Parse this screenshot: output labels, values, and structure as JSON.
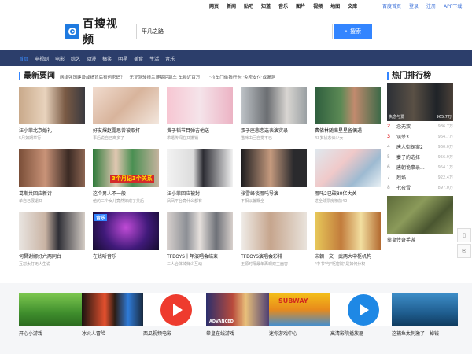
{
  "topbar": {
    "links": [
      "网页",
      "新闻",
      "贴吧",
      "知道",
      "音乐",
      "图片",
      "视频",
      "地图",
      "文库"
    ],
    "right": [
      "百度首页",
      "登录",
      "注册",
      "APP下载"
    ]
  },
  "logo": {
    "name": "百搜视频"
  },
  "search": {
    "value": "平凡之路",
    "button": "搜索"
  },
  "nav": {
    "items": [
      "首页",
      "电视剧",
      "电影",
      "综艺",
      "动漫",
      "搞笑",
      "明星",
      "美食",
      "生活",
      "音乐"
    ],
    "active_index": 0
  },
  "news": {
    "title": "最新要闻",
    "headlines": [
      "网络强国建设成绩背后有何密码？",
      "无证驾驶撞兰博基尼跑车 车损近百万！",
      "\"拉车门偷钱行卡 '免密支付'成漏洞"
    ],
    "items": [
      {
        "caption": "汪小菲北京婚礼",
        "sub": "5月如期举行"
      },
      {
        "caption": "好友爆赵露思曾被取打",
        "sub": "事后说自己离多了"
      },
      {
        "caption": "黄子韬节目弹吉他送",
        "sub": "求婚传闻在又撤销"
      },
      {
        "caption": "双子座悲恋选表演实录",
        "sub": "猫咪由回自觉不已"
      },
      {
        "caption": "费依林随南星星留偶遇",
        "sub": "43岁状态似少女"
      },
      {
        "caption": "葛斯共回应新诗",
        "sub": "单自己展退又"
      },
      {
        "caption": "这个男人不一般！",
        "sub": "他的三个女儿竟然嫁成了美后"
      },
      {
        "caption": "汪小菲回应被封",
        "sub": "凤凤平台竟什么都有"
      },
      {
        "caption": "张雪峰谈哪吒导演",
        "sub": "不相以偏概全"
      },
      {
        "caption": "哪吒2已破80亿大关",
        "sub": "进全球票房榜前40"
      },
      {
        "caption": "何炅谢娜好六两同台",
        "sub": "互怼太打无人生说"
      },
      {
        "caption": "在线听音乐",
        "sub": ""
      },
      {
        "caption": "TFBOYS十年演唱会结束",
        "sub": "三人合体掉鲜少互动"
      },
      {
        "caption": "TFBOYS演唱会彩排",
        "sub": "王源时隔最年再现双主面容"
      },
      {
        "caption": "宋朝一文一武两大中枢机构",
        "sub": "\"中书\"与\"枢密院\"是如何分权"
      }
    ]
  },
  "music_overlay": {
    "tile": "音乐",
    "banner": "3个月记3个关系",
    "banner_pre": "3个"
  },
  "rank": {
    "title": "热门排行榜",
    "top_caption": "执念与爱",
    "top_count": "965.7万",
    "rows": [
      {
        "n": "2",
        "t": "念无双",
        "c": "986.7万"
      },
      {
        "n": "3",
        "t": "误杀3",
        "c": "964.7万"
      },
      {
        "n": "4",
        "t": "唐人街探案2",
        "c": "960.0万"
      },
      {
        "n": "5",
        "t": "妻子的选择",
        "c": "956.9万"
      },
      {
        "n": "6",
        "t": "唐朝诡事录...",
        "c": "954.1万"
      },
      {
        "n": "7",
        "t": "烈焰",
        "c": "922.4万"
      },
      {
        "n": "8",
        "t": "七夜雪",
        "c": "897.0万"
      }
    ],
    "extra": {
      "caption": "拳皇传奇手游"
    }
  },
  "games": [
    {
      "caption": "开心小游戏"
    },
    {
      "caption": "冰火人冒险"
    },
    {
      "caption": "西瓜视频电影"
    },
    {
      "caption": "拳皇在线游戏"
    },
    {
      "caption": "迷你游戏中心"
    },
    {
      "caption": "高清影院播放器"
    },
    {
      "caption": "这捕鱼太刺激了！掉钱"
    }
  ],
  "game_overlays": {
    "superman": "SUBWAY",
    "advanced": "ADVANCED"
  },
  "colors": {
    "accent": "#3385ff",
    "nav_bg": "#2c3e6b",
    "hot": "#e4393c"
  }
}
